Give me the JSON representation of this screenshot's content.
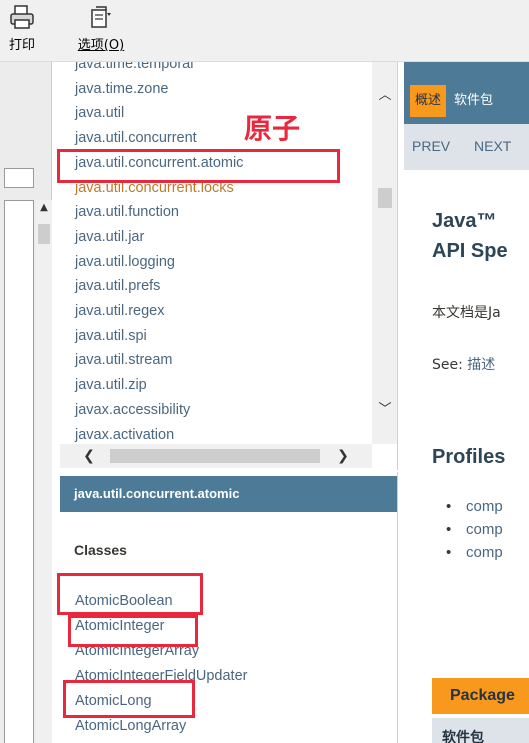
{
  "toolbar": {
    "print": {
      "label": "打印",
      "icon": "printer-icon"
    },
    "options": {
      "label": "选项(O)",
      "icon": "options-icon"
    }
  },
  "package_list": {
    "items": [
      "java.time.temporal",
      "java.time.zone",
      "java.util",
      "java.util.concurrent",
      "java.util.concurrent.atomic",
      "java.util.concurrent.locks",
      "java.util.function",
      "java.util.jar",
      "java.util.logging",
      "java.util.prefs",
      "java.util.regex",
      "java.util.spi",
      "java.util.stream",
      "java.util.zip",
      "javax.accessibility",
      "javax.activation"
    ],
    "visited_item": "java.util.concurrent.locks"
  },
  "class_frame": {
    "package_name": "java.util.concurrent.atomic",
    "section_title": "Classes",
    "classes": [
      "AtomicBoolean",
      "AtomicInteger",
      "AtomicIntegerArray",
      "AtomicIntegerFieldUpdater",
      "AtomicLong",
      "AtomicLongArray"
    ]
  },
  "main": {
    "nav_tabs": [
      "概述",
      "软件包"
    ],
    "subnav": [
      "PREV",
      "NEXT"
    ],
    "title_line1": "Java™",
    "title_line2": "API Spe",
    "description": "本文档是Ja",
    "see_label": "See: ",
    "see_link": "描述",
    "profiles_title": "Profiles",
    "profiles": [
      "comp",
      "comp",
      "comp"
    ],
    "package_tab": "Package",
    "package_col_header": "软件包"
  },
  "annotation": {
    "text": "原子",
    "color": "#e8283c"
  },
  "colors": {
    "link": "#4a6782",
    "visited": "#bb7a2a",
    "header_bg": "#4d7a97",
    "accent": "#f8981d"
  }
}
